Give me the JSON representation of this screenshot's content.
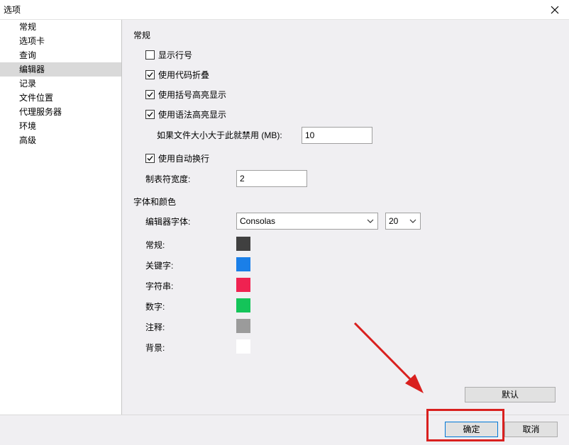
{
  "window": {
    "title": "选项"
  },
  "sidebar": {
    "items": [
      {
        "label": "常规"
      },
      {
        "label": "选项卡"
      },
      {
        "label": "查询"
      },
      {
        "label": "编辑器"
      },
      {
        "label": "记录"
      },
      {
        "label": "文件位置"
      },
      {
        "label": "代理服务器"
      },
      {
        "label": "环境"
      },
      {
        "label": "高级"
      }
    ],
    "selected": "编辑器"
  },
  "general": {
    "title": "常规",
    "show_line_numbers": {
      "label": "显示行号",
      "checked": false
    },
    "code_folding": {
      "label": "使用代码折叠",
      "checked": true
    },
    "bracket_highlight": {
      "label": "使用括号高亮显示",
      "checked": true
    },
    "syntax_highlight": {
      "label": "使用语法高亮显示",
      "checked": true
    },
    "disable_size_label": "如果文件大小大于此就禁用 (MB):",
    "disable_size_value": "10",
    "word_wrap": {
      "label": "使用自动换行",
      "checked": true
    },
    "tab_width_label": "制表符宽度:",
    "tab_width_value": "2"
  },
  "font_colors": {
    "title": "字体和颜色",
    "font_label": "编辑器字体:",
    "font_value": "Consolas",
    "size_value": "20",
    "colors": [
      {
        "label": "常规:",
        "color": "#404040"
      },
      {
        "label": "关键字:",
        "color": "#1a7fe8"
      },
      {
        "label": "字符串:",
        "color": "#ef2251"
      },
      {
        "label": "数字:",
        "color": "#14c459"
      },
      {
        "label": "注释:",
        "color": "#9b9b9b"
      },
      {
        "label": "背景:",
        "color": "#ffffff"
      }
    ]
  },
  "buttons": {
    "default": "默认",
    "ok": "确定",
    "cancel": "取消"
  },
  "annotation": {
    "color": "#d9201f"
  }
}
